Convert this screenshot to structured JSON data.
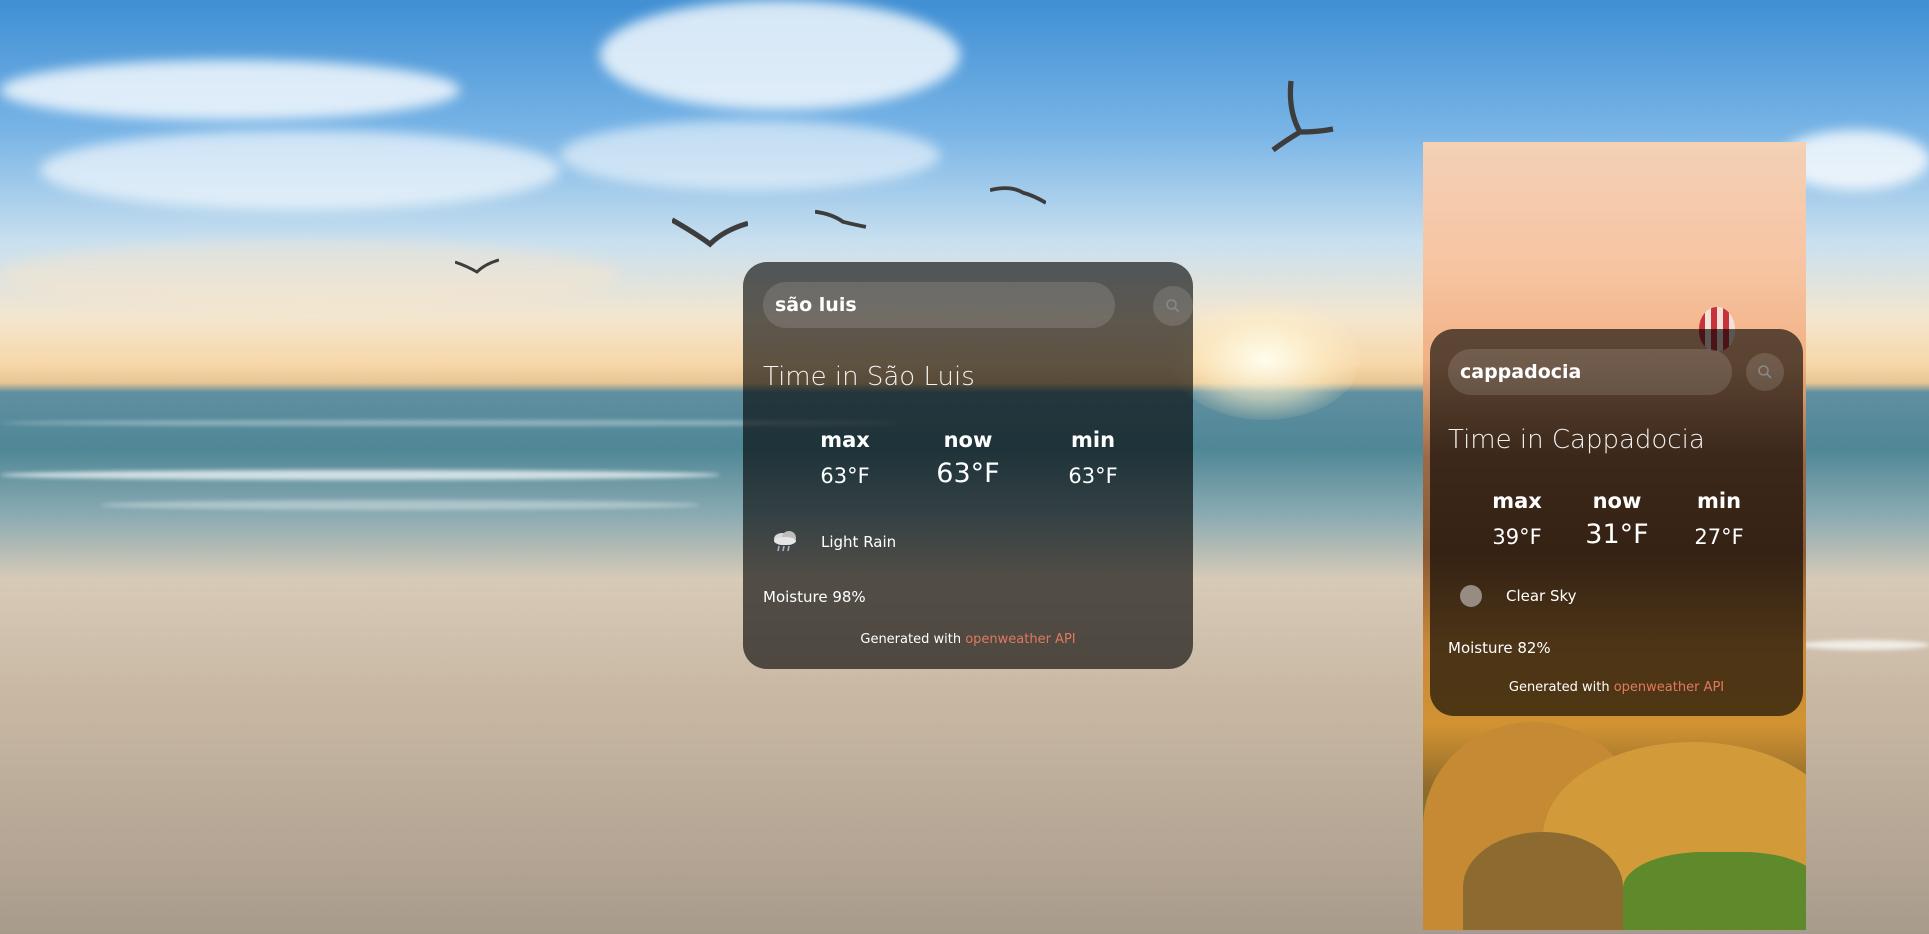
{
  "colors": {
    "card_bg": "rgba(0,0,0,0.62)",
    "api_link": "#e07a5f",
    "text": "#ffffff"
  },
  "cards": [
    {
      "search_value": "são luis",
      "title": "Time in São Luis",
      "max_label": "max",
      "now_label": "now",
      "min_label": "min",
      "max_value": "63°F",
      "now_value": "63°F",
      "min_value": "63°F",
      "condition_icon": "rain-cloud-icon",
      "condition": "Light Rain",
      "moisture": "Moisture 98%",
      "footer_prefix": "Generated with",
      "footer_link": "openweather API"
    },
    {
      "search_value": "cappadocia",
      "title": "Time in Cappadocia",
      "max_label": "max",
      "now_label": "now",
      "min_label": "min",
      "max_value": "39°F",
      "now_value": "31°F",
      "min_value": "27°F",
      "condition_icon": "clear-sky-icon",
      "condition": "Clear Sky",
      "moisture": "Moisture 82%",
      "footer_prefix": "Generated with",
      "footer_link": "openweather API"
    }
  ]
}
